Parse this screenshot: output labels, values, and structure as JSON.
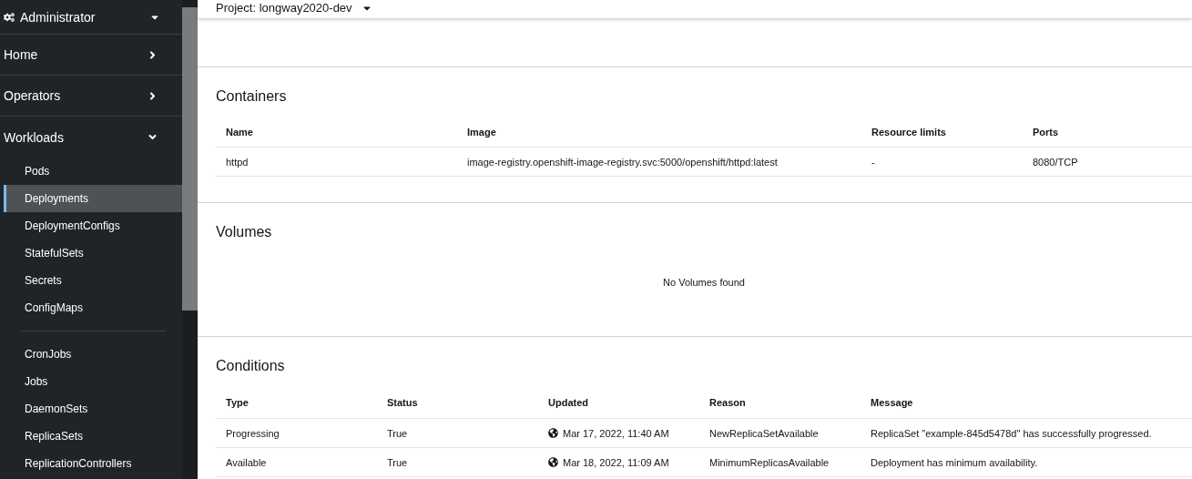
{
  "sidebar": {
    "perspective": {
      "label": "Administrator"
    },
    "groups": [
      {
        "label": "Home",
        "expanded": false
      },
      {
        "label": "Operators",
        "expanded": false
      },
      {
        "label": "Workloads",
        "expanded": true,
        "items": [
          {
            "kind": "link",
            "label": "Pods",
            "selected": false
          },
          {
            "kind": "link",
            "label": "Deployments",
            "selected": true
          },
          {
            "kind": "link",
            "label": "DeploymentConfigs",
            "selected": false
          },
          {
            "kind": "link",
            "label": "StatefulSets",
            "selected": false
          },
          {
            "kind": "link",
            "label": "Secrets",
            "selected": false
          },
          {
            "kind": "link",
            "label": "ConfigMaps",
            "selected": false
          },
          {
            "kind": "separator"
          },
          {
            "kind": "link",
            "label": "CronJobs",
            "selected": false
          },
          {
            "kind": "link",
            "label": "Jobs",
            "selected": false
          },
          {
            "kind": "link",
            "label": "DaemonSets",
            "selected": false
          },
          {
            "kind": "link",
            "label": "ReplicaSets",
            "selected": false
          },
          {
            "kind": "link",
            "label": "ReplicationControllers",
            "selected": false
          }
        ]
      }
    ]
  },
  "topbar": {
    "project": "Project: longway2020-dev"
  },
  "containers": {
    "title": "Containers",
    "columns": [
      "Name",
      "Image",
      "Resource limits",
      "Ports"
    ],
    "rows": [
      [
        "httpd",
        "image-registry.openshift-image-registry.svc:5000/openshift/httpd:latest",
        "-",
        "8080/TCP"
      ]
    ]
  },
  "volumes": {
    "title": "Volumes",
    "empty": "No Volumes found"
  },
  "conditions": {
    "title": "Conditions",
    "columns": [
      "Type",
      "Status",
      "Updated",
      "Reason",
      "Message"
    ],
    "rows": [
      {
        "type": "Progressing",
        "status": "True",
        "updated": "Mar 17, 2022, 11:40 AM",
        "reason": "NewReplicaSetAvailable",
        "message": "ReplicaSet \"example-845d5478d\" has successfully progressed."
      },
      {
        "type": "Available",
        "status": "True",
        "updated": "Mar 18, 2022, 11:09 AM",
        "reason": "MinimumReplicasAvailable",
        "message": "Deployment has minimum availability."
      }
    ]
  }
}
